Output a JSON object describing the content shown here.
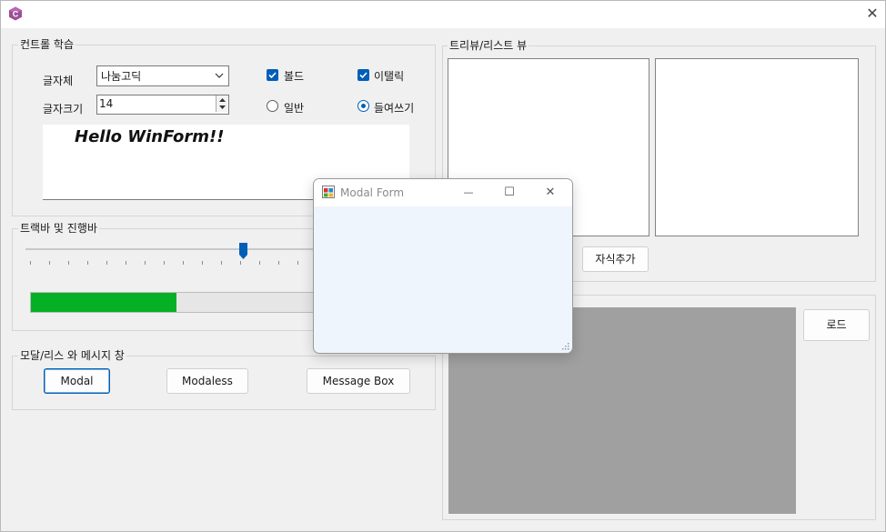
{
  "window": {
    "icon": "csharp-app-icon",
    "close_glyph": "✕"
  },
  "controls_group": {
    "title": "컨트롤 학습",
    "font_label": "글자체",
    "font_value": "나눔고딕",
    "size_label": "글자크기",
    "size_value": "14",
    "bold_label": "볼드",
    "bold_checked": true,
    "italic_label": "이탤릭",
    "italic_checked": true,
    "normal_label": "일반",
    "normal_selected": false,
    "indent_label": "들여쓰기",
    "indent_selected": true,
    "preview_text": "Hello WinForm!!"
  },
  "trackbar_group": {
    "title": "트랙바 및 진행바",
    "progress_fraction": 0.5
  },
  "modal_group": {
    "title": "모달/리스 와 메시지 창",
    "modal_button": "Modal",
    "modaless_button": "Modaless",
    "messagebox_button": "Message Box"
  },
  "treelist_group": {
    "title": "트리뷰/리스트 뷰",
    "add_child_button": "자식추가"
  },
  "picture_group": {
    "load_button": "로드"
  },
  "modal_form": {
    "title": "Modal Form",
    "minimize_glyph": "—",
    "maximize_glyph": "☐",
    "close_glyph": "✕"
  },
  "colors": {
    "accent": "#005fb8",
    "progress": "#06b025",
    "picture_bg": "#a0a0a0"
  }
}
